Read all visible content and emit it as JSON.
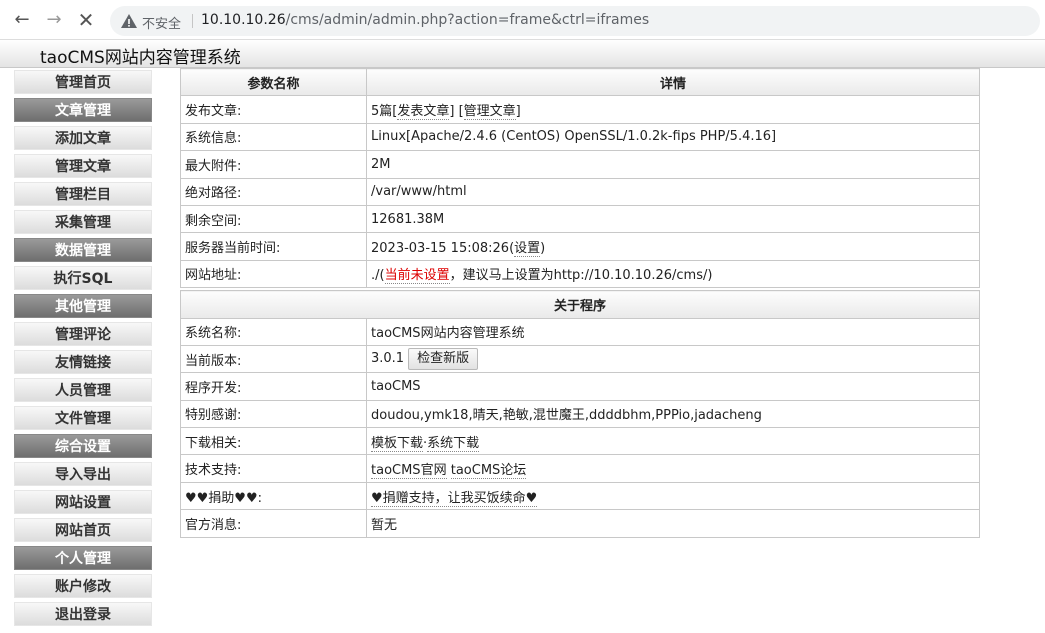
{
  "browser": {
    "insecure_label": "不安全",
    "url_host": "10.10.10.26",
    "url_path": "/cms/admin/admin.php?action=frame&ctrl=iframes"
  },
  "app": {
    "title": "taoCMS网站内容管理系统"
  },
  "sidebar": {
    "items": [
      {
        "label": "管理首页",
        "group": false
      },
      {
        "label": "文章管理",
        "group": true
      },
      {
        "label": "添加文章",
        "group": false
      },
      {
        "label": "管理文章",
        "group": false
      },
      {
        "label": "管理栏目",
        "group": false
      },
      {
        "label": "采集管理",
        "group": false
      },
      {
        "label": "数据管理",
        "group": true
      },
      {
        "label": "执行SQL",
        "group": false
      },
      {
        "label": "其他管理",
        "group": true
      },
      {
        "label": "管理评论",
        "group": false
      },
      {
        "label": "友情链接",
        "group": false
      },
      {
        "label": "人员管理",
        "group": false
      },
      {
        "label": "文件管理",
        "group": false
      },
      {
        "label": "综合设置",
        "group": true
      },
      {
        "label": "导入导出",
        "group": false
      },
      {
        "label": "网站设置",
        "group": false
      },
      {
        "label": "网站首页",
        "group": false
      },
      {
        "label": "个人管理",
        "group": true
      },
      {
        "label": "账户修改",
        "group": false
      },
      {
        "label": "退出登录",
        "group": false
      }
    ]
  },
  "params": {
    "col_name": "参数名称",
    "col_detail": "详情",
    "publish_label": "发布文章:",
    "publish_count": "5篇",
    "publish_link": "发表文章",
    "manage_link": "管理文章",
    "sysinfo_label": "系统信息:",
    "sysinfo_value": "Linux[Apache/2.4.6 (CentOS) OpenSSL/1.0.2k-fips PHP/5.4.16]",
    "attach_label": "最大附件:",
    "attach_value": "2M",
    "path_label": "绝对路径:",
    "path_value": "/var/www/html",
    "space_label": "剩余空间:",
    "space_value": "12681.38M",
    "time_label": "服务器当前时间:",
    "time_value": "2023-03-15 15:08:26",
    "time_link": "设置",
    "site_label": "网站地址:",
    "site_prefix": "./(",
    "site_unset": "当前未设置",
    "site_suffix": "，建议马上设置为http://10.10.10.26/cms/)"
  },
  "about": {
    "heading": "关于程序",
    "name_label": "系统名称:",
    "name_value": "taoCMS网站内容管理系统",
    "version_label": "当前版本:",
    "version_value": "3.0.1",
    "check_update": "检查新版",
    "dev_label": "程序开发:",
    "dev_value": "taoCMS",
    "thanks_label": "特别感谢:",
    "thanks_value": "doudou,ymk18,晴天,艳敏,混世魔王,ddddbhm,PPPio,jadacheng",
    "download_label": "下载相关:",
    "download_tpl": "模板下载",
    "download_sep": "·",
    "download_sys": "系统下载",
    "support_label": "技术支持:",
    "support_site": "taoCMS官网",
    "support_forum": "taoCMS论坛",
    "donate_label": "♥♥捐助♥♥:",
    "donate_link": "♥捐赠支持，让我买饭续命♥",
    "news_label": "官方消息:",
    "news_value": "暂无"
  }
}
